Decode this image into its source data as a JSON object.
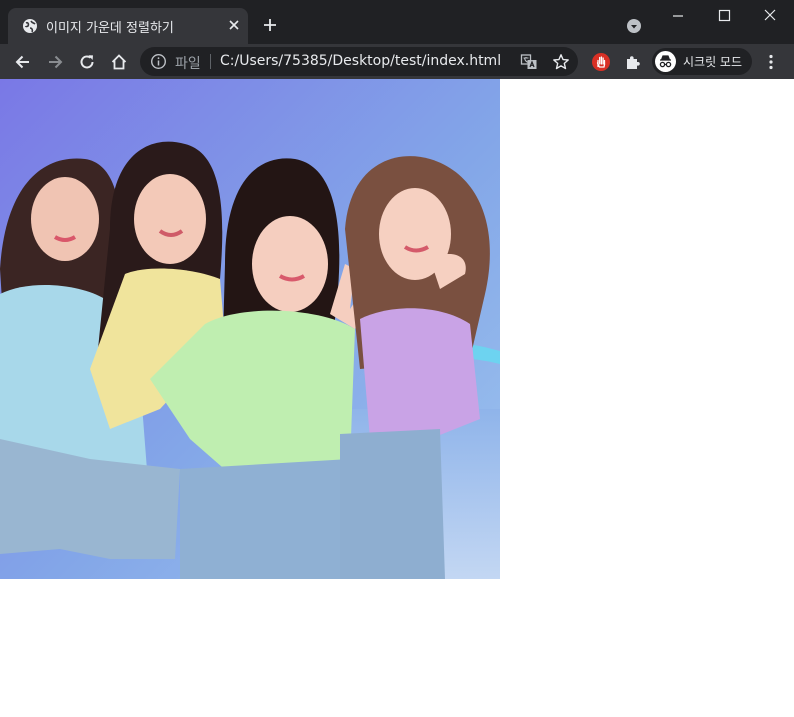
{
  "tab": {
    "title": "이미지 가운데 정렬하기",
    "favicon": "globe-icon"
  },
  "address_bar": {
    "scheme_label": "파일",
    "url": "C:/Users/75385/Desktop/test/index.html"
  },
  "incognito": {
    "label": "시크릿 모드"
  },
  "colors": {
    "titlebar": "#202124",
    "toolbar": "#35363a",
    "omnibox": "#202124",
    "text": "#e8eaed",
    "extension_red": "#d93025"
  },
  "icons": [
    "globe-icon",
    "close-icon",
    "plus-icon",
    "tab-search-icon",
    "minimize-icon",
    "maximize-icon",
    "window-close-icon",
    "back-arrow-icon",
    "forward-arrow-icon",
    "reload-icon",
    "home-icon",
    "info-icon",
    "translate-icon",
    "star-icon",
    "hand-extension-icon",
    "puzzle-icon",
    "incognito-icon",
    "kebab-menu-icon"
  ]
}
